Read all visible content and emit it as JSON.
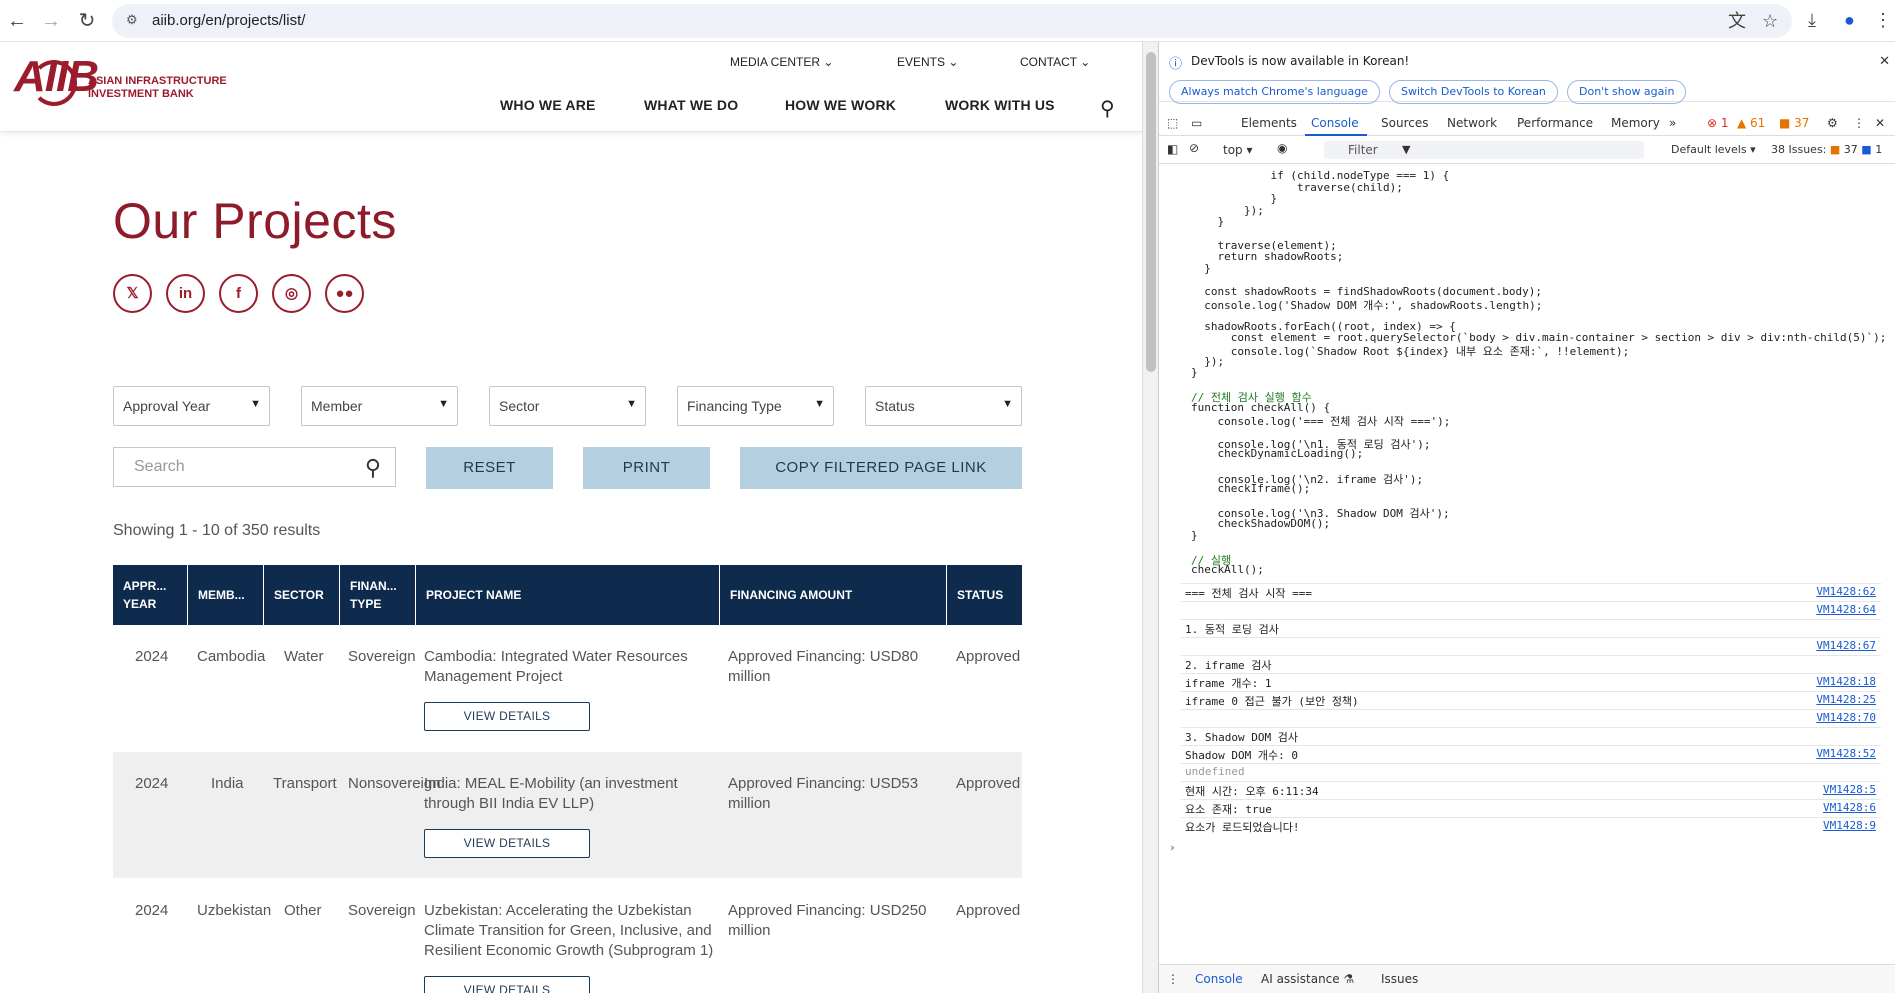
{
  "browser": {
    "url": "aiib.org/en/projects/list/"
  },
  "site": {
    "logo": "AIIB",
    "logo_sub": "ASIAN INFRASTRUCTURE INVESTMENT BANK",
    "top_links": [
      "MEDIA CENTER",
      "EVENTS",
      "CONTACT"
    ],
    "main_links": [
      "WHO WE ARE",
      "WHAT WE DO",
      "HOW WE WORK",
      "WORK WITH US"
    ],
    "page_title": "Our Projects",
    "filters": [
      "Approval Year",
      "Member",
      "Sector",
      "Financing Type",
      "Status"
    ],
    "search_placeholder": "Search",
    "buttons": {
      "reset": "RESET",
      "print": "PRINT",
      "copy": "COPY FILTERED PAGE LINK"
    },
    "results": "Showing 1 - 10 of 350 results",
    "table": {
      "headers": [
        "APPR... YEAR",
        "MEMB...",
        "SECTOR",
        "FINAN... TYPE",
        "PROJECT NAME",
        "FINANCING AMOUNT",
        "STATUS"
      ],
      "rows": [
        {
          "year": "2024",
          "member": "Cambodia",
          "sector": "Water",
          "type": "Sovereign",
          "name": "Cambodia: Integrated Water Resources Management Project",
          "amount": "Approved Financing: USD80 million",
          "status": "Approved"
        },
        {
          "year": "2024",
          "member": "India",
          "sector": "Transport",
          "type": "Nonsovereign",
          "name": "India: MEAL E-Mobility (an investment through BII India EV LLP)",
          "amount": "Approved Financing: USD53 million",
          "status": "Approved"
        },
        {
          "year": "2024",
          "member": "Uzbekistan",
          "sector": "Other",
          "type": "Sovereign",
          "name": "Uzbekistan: Accelerating the Uzbekistan Climate Transition for Green, Inclusive, and Resilient Economic Growth (Subprogram 1)",
          "amount": "Approved Financing: USD250 million",
          "status": "Approved"
        }
      ],
      "view_details": "VIEW DETAILS"
    }
  },
  "devtools": {
    "notice": "DevTools is now available in Korean!",
    "pills": [
      "Always match Chrome's language",
      "Switch DevTools to Korean",
      "Don't show again"
    ],
    "tabs": [
      "Elements",
      "Console",
      "Sources",
      "Network",
      "Performance",
      "Memory"
    ],
    "counts": {
      "errors": "1",
      "warnings": "61",
      "issues": "37"
    },
    "context": "top",
    "filter_placeholder": "Filter",
    "levels": "Default levels",
    "issues_label": "38 Issues:",
    "issues_a": "37",
    "issues_b": "1",
    "code_lines": [
      "            if (child.nodeType === 1) {",
      "                traverse(child);",
      "            }",
      "        });",
      "    }",
      "",
      "    traverse(element);",
      "    return shadowRoots;",
      "  }",
      "",
      "  const shadowRoots = findShadowRoots(document.body);",
      "  console.log('Shadow DOM 개수:', shadowRoots.length);",
      "",
      "  shadowRoots.forEach((root, index) => {",
      "      const element = root.querySelector(`body > div.main-container > section > div > div:nth-child(5)`);",
      "      console.log(`Shadow Root ${index} 내부 요소 존재:`, !!element);",
      "  });",
      "}",
      "",
      "// 전체 검사 실행 함수",
      "function checkAll() {",
      "    console.log('=== 전체 검사 시작 ===');",
      "",
      "    console.log('\\n1. 동적 로딩 검사');",
      "    checkDynamicLoading();",
      "",
      "    console.log('\\n2. iframe 검사');",
      "    checkIframe();",
      "",
      "    console.log('\\n3. Shadow DOM 검사');",
      "    checkShadowDOM();",
      "}",
      "",
      "// 실행",
      "checkAll();"
    ],
    "messages": [
      {
        "text": "=== 전체 검사 시작 ===",
        "src": "VM1428:62"
      },
      {
        "text": "",
        "src": "VM1428:64"
      },
      {
        "text": "1. 동적 로딩 검사",
        "src": ""
      },
      {
        "text": "",
        "src": "VM1428:67"
      },
      {
        "text": "2. iframe 검사",
        "src": ""
      },
      {
        "text": "iframe 개수: 1",
        "src": "VM1428:18"
      },
      {
        "text": "iframe 0 접근 불가 (보안 정책)",
        "src": "VM1428:25"
      },
      {
        "text": "",
        "src": "VM1428:70"
      },
      {
        "text": "3. Shadow DOM 검사",
        "src": ""
      },
      {
        "text": "Shadow DOM 개수: 0",
        "src": "VM1428:52"
      },
      {
        "text": "undefined",
        "src": ""
      },
      {
        "text": "현재 시간: 오후 6:11:34",
        "src": "VM1428:5"
      },
      {
        "text": "요소 존재: true",
        "src": "VM1428:6"
      },
      {
        "text": "요소가 로드되었습니다!",
        "src": "VM1428:9"
      }
    ],
    "bottom_tabs": [
      "Console",
      "AI assistance",
      "Issues"
    ]
  }
}
